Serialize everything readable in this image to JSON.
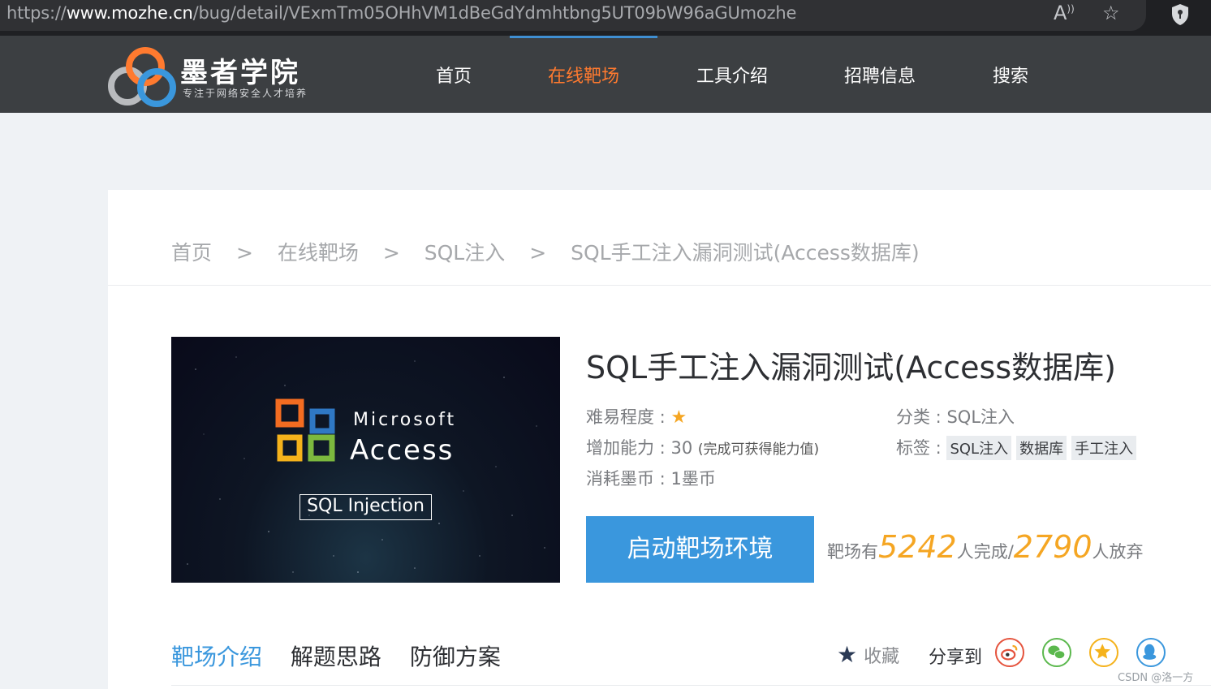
{
  "browser": {
    "url_scheme": "https://",
    "url_host": "www.mozhe.cn",
    "url_path": "/bug/detail/VExmTm05OHhVM1dBeGdYdmhtbng5UT09bW96aGUmozhe",
    "read_aloud_icon": "read-aloud-icon",
    "favorite_icon": "star-outline-icon",
    "extension_icon": "shield-icon"
  },
  "site": {
    "logo_title": "墨者学院",
    "logo_subtitle": "专注于网络安全人才培养",
    "nav": [
      {
        "label": "首页",
        "active": false
      },
      {
        "label": "在线靶场",
        "active": true
      },
      {
        "label": "工具介绍",
        "active": false
      },
      {
        "label": "招聘信息",
        "active": false
      },
      {
        "label": "搜索",
        "active": false
      }
    ],
    "colors": {
      "nav_bg": "#3c3f42",
      "accent_orange": "#ff7a2f",
      "primary_blue": "#3a97dd",
      "count_orange": "#f5a623"
    }
  },
  "breadcrumb": {
    "items": [
      "首页",
      "在线靶场",
      "SQL注入",
      "SQL手工注入漏洞测试(Access数据库)"
    ],
    "separator": ">"
  },
  "cover": {
    "brand": "Microsoft",
    "product": "Access",
    "caption": "SQL Injection"
  },
  "detail": {
    "title": "SQL手工注入漏洞测试(Access数据库)",
    "difficulty_label": "难易程度 :",
    "difficulty_stars": 1,
    "ability_label": "增加能力 :",
    "ability_value": "30",
    "ability_note": "(完成可获得能力值)",
    "cost_label": "消耗墨币 :",
    "cost_value": "1墨币",
    "category_label": "分类 :",
    "category_value": "SQL注入",
    "tags_label": "标签 :",
    "tags": [
      "SQL注入",
      "数据库",
      "手工注入"
    ]
  },
  "action": {
    "start_button": "启动靶场环境",
    "stats_prefix": "靶场有",
    "completed_count": "5242",
    "completed_suffix": "人完成/",
    "abandoned_count": "2790",
    "abandoned_suffix": "人放弃"
  },
  "tabs": [
    {
      "label": "靶场介绍",
      "active": true
    },
    {
      "label": "解题思路",
      "active": false
    },
    {
      "label": "防御方案",
      "active": false
    }
  ],
  "social": {
    "favorite_label": "收藏",
    "share_label": "分享到",
    "share_targets": [
      "weibo-icon",
      "wechat-icon",
      "qzone-icon",
      "qq-icon"
    ]
  },
  "watermark": "CSDN @洛一方"
}
